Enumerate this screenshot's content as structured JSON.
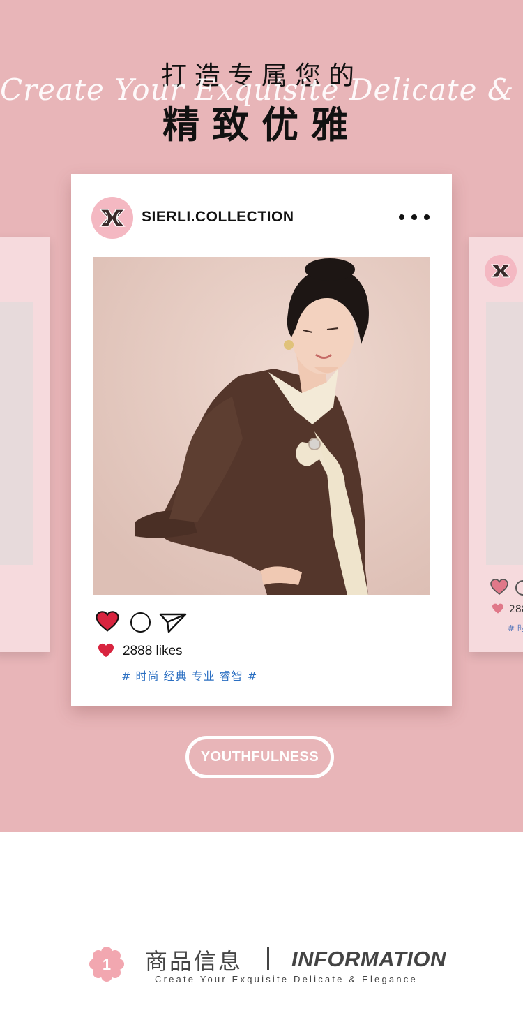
{
  "hero": {
    "title_line1": "打造专属您的",
    "script_text": "Create Your Exquisite Delicate & Elegance",
    "title_line2": "精致优雅"
  },
  "post": {
    "account_name": "SIERLI.COLLECTION",
    "more_icon": "more-dots-icon",
    "avatar_icon": "sierli-logo-icon",
    "like_icon": "heart-icon",
    "comment_icon": "comment-circle-icon",
    "share_icon": "paper-plane-icon",
    "likes_text": "2888 likes",
    "hashtags": "# 时尚 经典 专业 睿智 #"
  },
  "side_card_right": {
    "likes_partial": "288",
    "tag_partial": "# 时"
  },
  "button": {
    "label": "YOUTHFULNESS"
  },
  "section": {
    "number": "1",
    "title_cn": "商品信息",
    "title_en": "INFORMATION",
    "subtitle": "Create Your Exquisite Delicate & Elegance"
  },
  "colors": {
    "background_pink": "#e8b5b8",
    "side_card_pink": "#f6dadd",
    "heart_red": "#d8243f",
    "hashtag_blue": "#2b6fc2",
    "avatar_pink": "#f4b8c2"
  }
}
